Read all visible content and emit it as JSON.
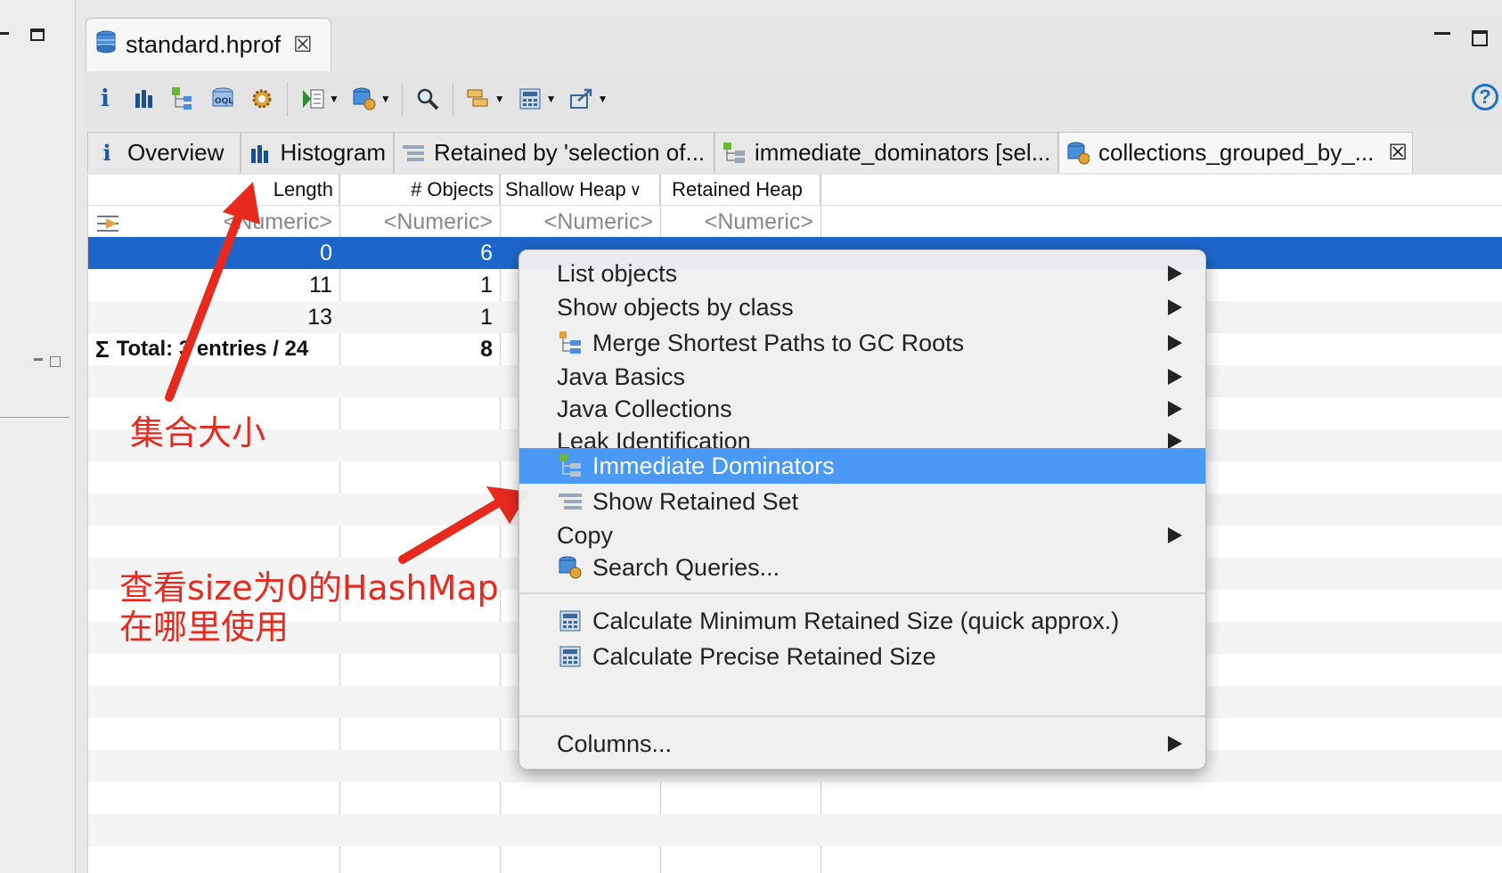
{
  "editor_tab": {
    "title": "standard.hprof",
    "close": "☒"
  },
  "result_tabs": [
    {
      "label": "Overview",
      "icon": "info-icon"
    },
    {
      "label": "Histogram",
      "icon": "histogram-icon"
    },
    {
      "label": "Retained by 'selection of...",
      "icon": "retained-set-icon"
    },
    {
      "label": "immediate_dominators [sel...",
      "icon": "dominator-icon"
    },
    {
      "label": "collections_grouped_by_...",
      "icon": "query-icon",
      "close": "☒"
    }
  ],
  "table": {
    "columns": [
      "Length",
      "# Objects",
      "Shallow Heap",
      "Retained Heap"
    ],
    "sort_indicator": "∨",
    "filter_placeholders": [
      "<Numeric>",
      "<Numeric>",
      "<Numeric>",
      "<Numeric>"
    ],
    "rows": [
      {
        "length": "0",
        "objects": "6"
      },
      {
        "length": "11",
        "objects": "1"
      },
      {
        "length": "13",
        "objects": "1"
      }
    ],
    "total": {
      "sigma": "Σ",
      "label": "Total: 3 entries / 24",
      "objects": "8"
    }
  },
  "context_menu": {
    "items": [
      {
        "label": "List objects",
        "submenu": true
      },
      {
        "label": "Show objects by class",
        "submenu": true
      },
      {
        "label": "Merge Shortest Paths to GC Roots",
        "submenu": true,
        "icon": "gc-roots-icon"
      },
      {
        "label": "Java Basics",
        "submenu": true
      },
      {
        "label": "Java Collections",
        "submenu": true
      },
      {
        "label": "Leak Identification",
        "submenu": true
      },
      {
        "label": "Immediate Dominators",
        "submenu": false,
        "icon": "dominator-icon",
        "highlighted": true
      },
      {
        "label": "Show Retained Set",
        "submenu": false,
        "icon": "retained-set-icon"
      },
      {
        "label": "Copy",
        "submenu": true
      },
      {
        "label": "Search Queries...",
        "submenu": false,
        "icon": "query-icon"
      },
      {
        "label": "Calculate Minimum Retained Size (quick approx.)",
        "submenu": false,
        "icon": "calculator-icon"
      },
      {
        "label": "Calculate Precise Retained Size",
        "submenu": false,
        "icon": "calculator-icon"
      },
      {
        "label": "Columns...",
        "submenu": true
      }
    ]
  },
  "annotations": {
    "collection_size": "集合大小",
    "where_used_line1": "查看size为0的HashMap",
    "where_used_line2": "在哪里使用",
    "color": "#e82a1e"
  },
  "help": "?",
  "colors": {
    "selection": "#1d66c9",
    "menu_highlight": "#4a9af5"
  }
}
